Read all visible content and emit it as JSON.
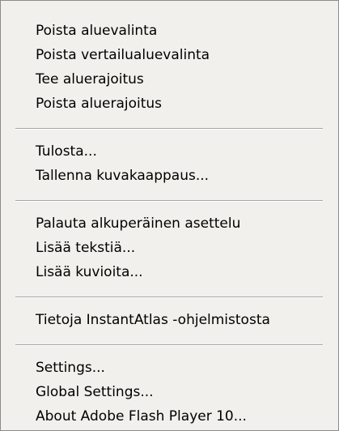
{
  "context_menu": {
    "group_selection": {
      "remove_area_selection": "Poista aluevalinta",
      "remove_comparison_area_selection": "Poista vertailualuevalinta",
      "make_item_filter": "Tee aluerajoitus",
      "remove_item_filter": "Poista aluerajoitus"
    },
    "group_output": {
      "print": "Tulosta...",
      "save_screenshot": "Tallenna kuvakaappaus..."
    },
    "group_layout": {
      "restore_original_layout": "Palauta alkuperäinen asettelu",
      "add_text": "Lisää tekstiä...",
      "add_shapes": "Lisää kuvioita..."
    },
    "group_about_app": {
      "about_instantatlas": "Tietoja InstantAtlas -ohjelmistosta"
    },
    "group_flash": {
      "settings": "Settings...",
      "global_settings": "Global Settings...",
      "about_flash_player": "About Adobe Flash Player 10..."
    }
  }
}
